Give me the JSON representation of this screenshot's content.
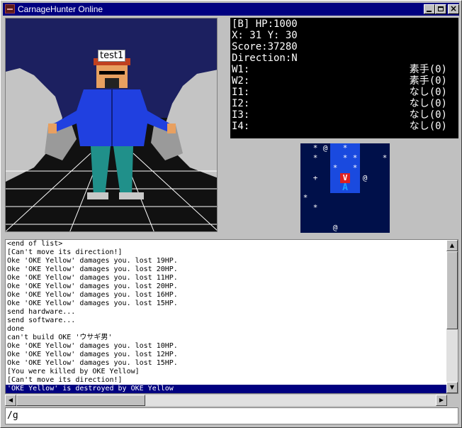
{
  "window": {
    "title": "CarnageHunter Online",
    "buttons": {
      "minimize": "_",
      "maximize": "□",
      "close": "×"
    }
  },
  "scene": {
    "player_name": "test1"
  },
  "status": {
    "hp": "[B] HP:1000",
    "position": "X: 31 Y: 30",
    "score": "Score:37280",
    "direction": "Direction:N",
    "slots": [
      {
        "label": "W1:",
        "value": "素手(0)"
      },
      {
        "label": "W2:",
        "value": "素手(0)"
      },
      {
        "label": "I1:",
        "value": "なし(0)"
      },
      {
        "label": "I2:",
        "value": "なし(0)"
      },
      {
        "label": "I3:",
        "value": "なし(0)"
      },
      {
        "label": "I4:",
        "value": "なし(0)"
      }
    ]
  },
  "radar": {
    "colors": {
      "background": "#00104a",
      "highlight": "#1a4adf",
      "enemy": "#e02020",
      "player": "#20a0ff"
    },
    "cells": [
      {
        "c": 1,
        "r": 0,
        "t": "*"
      },
      {
        "c": 2,
        "r": 0,
        "t": "@"
      },
      {
        "c": 4,
        "r": 0,
        "t": "*"
      },
      {
        "c": 1,
        "r": 1,
        "t": "*"
      },
      {
        "c": 4,
        "r": 1,
        "t": "*"
      },
      {
        "c": 5,
        "r": 1,
        "t": "*"
      },
      {
        "c": 8,
        "r": 1,
        "t": "*"
      },
      {
        "c": 3,
        "r": 2,
        "t": "*"
      },
      {
        "c": 5,
        "r": 2,
        "t": "*"
      },
      {
        "c": 1,
        "r": 3,
        "t": "+"
      },
      {
        "c": 6,
        "r": 3,
        "t": "@"
      },
      {
        "c": 0,
        "r": 5,
        "t": "*"
      },
      {
        "c": 1,
        "r": 6,
        "t": "*"
      },
      {
        "c": 3,
        "r": 8,
        "t": "@"
      }
    ],
    "enemy_marker": "V",
    "player_marker": "A"
  },
  "log": {
    "lines": [
      "<end of list>",
      "[Can't move its direction!]",
      "Oke 'OKE Yellow' damages you. lost 19HP.",
      "Oke 'OKE Yellow' damages you. lost 20HP.",
      "Oke 'OKE Yellow' damages you. lost 11HP.",
      "Oke 'OKE Yellow' damages you. lost 20HP.",
      "Oke 'OKE Yellow' damages you. lost 16HP.",
      "Oke 'OKE Yellow' damages you. lost 15HP.",
      "send hardware...",
      "send software...",
      "done",
      "can't build OKE 'ウサギ男'",
      "Oke 'OKE Yellow' damages you. lost 10HP.",
      "Oke 'OKE Yellow' damages you. lost 12HP.",
      "Oke 'OKE Yellow' damages you. lost 15HP.",
      "[You were killed by OKE Yellow]",
      "[Can't move its direction!]",
      "'OKE Yellow' is destroyed by OKE Yellow"
    ],
    "selected_index": 17
  },
  "command": {
    "value": "/g"
  }
}
